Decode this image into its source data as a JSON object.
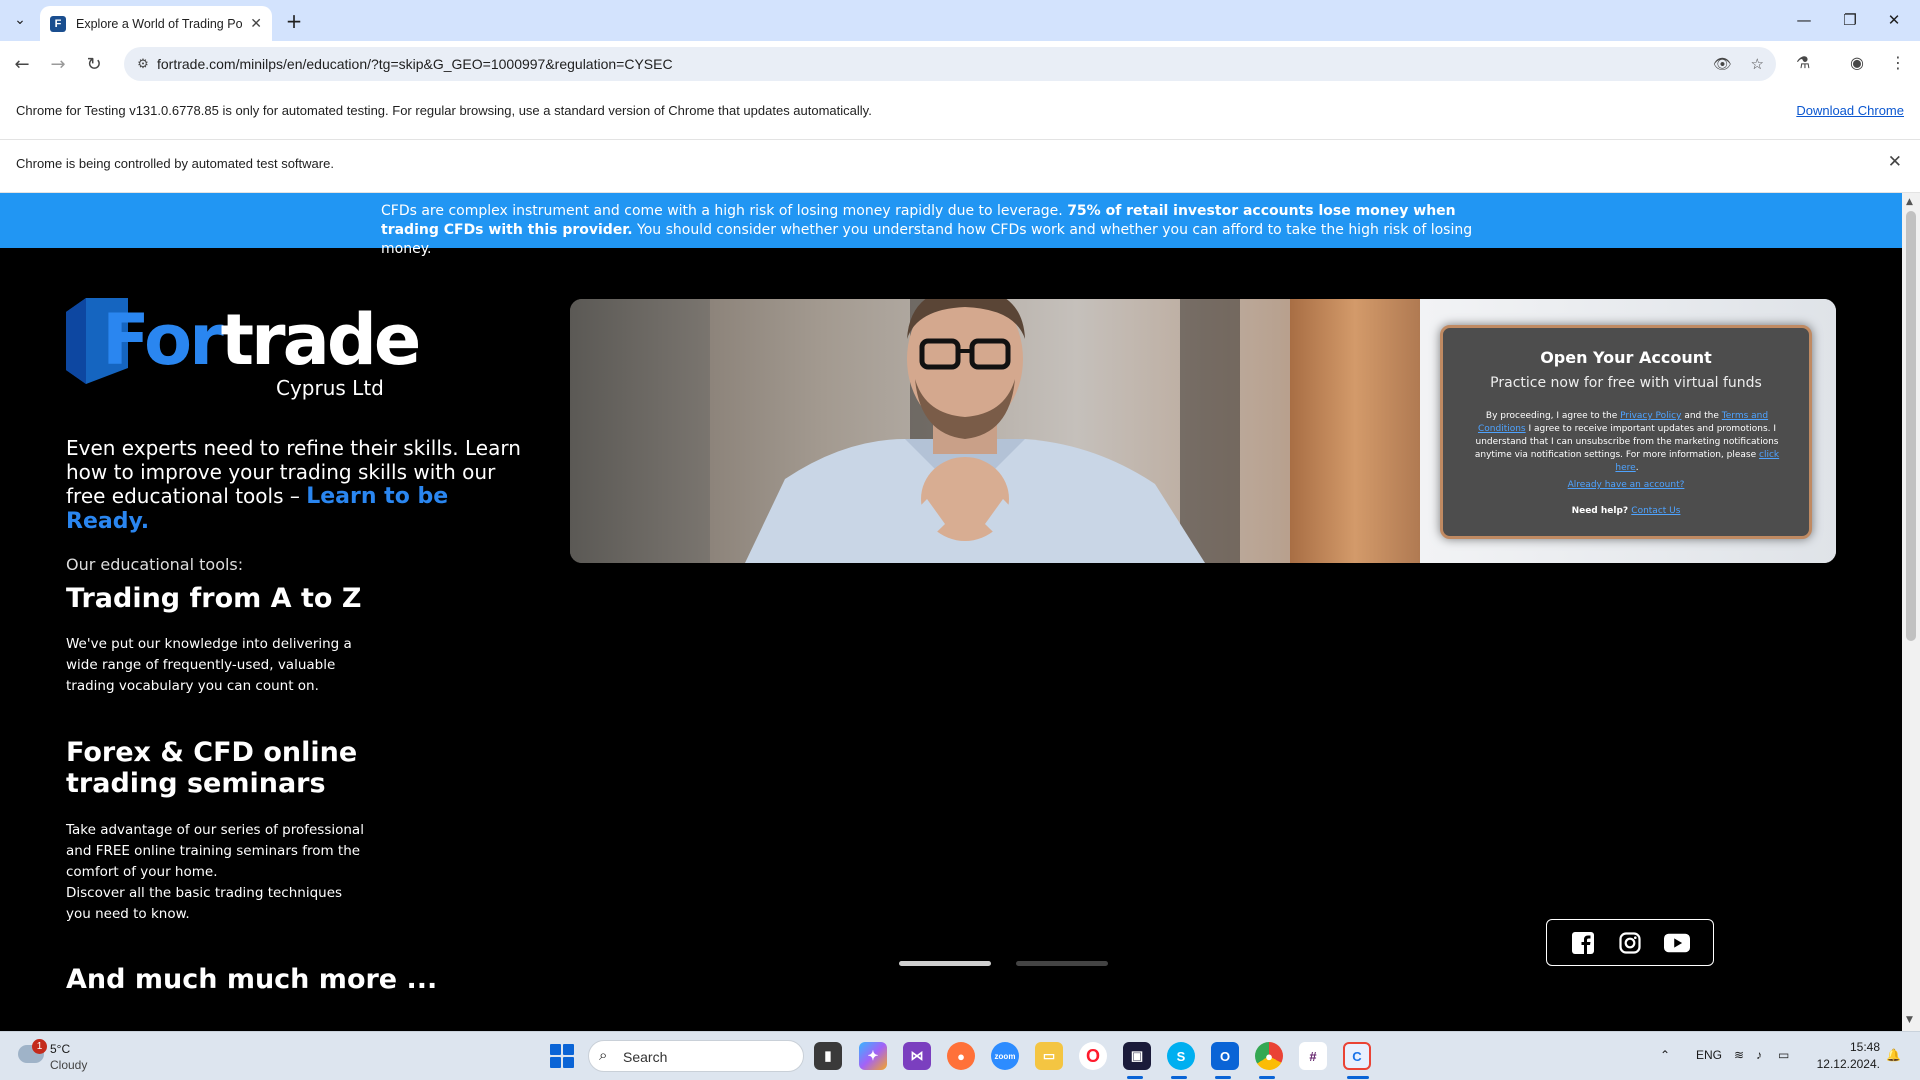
{
  "browser": {
    "tab_title": "Explore a World of Trading Possibilities",
    "url": "fortrade.com/minilps/en/education/?tg=skip&G_GEO=1000997&regulation=CYSEC",
    "info_testing": "Chrome for Testing v131.0.6778.85 is only for automated testing. For regular browsing, use a standard version of Chrome that updates automatically.",
    "download_link": "Download Chrome",
    "info_automation": "Chrome is being controlled by automated test software."
  },
  "banner": {
    "text_a": "CFDs are complex instrument and come with a high risk of losing money rapidly due to leverage.",
    "text_b": "75% of retail investor accounts lose money when trading CFDs with this provider.",
    "text_c": "You should consider whether you understand how CFDs work and whether you can afford to take the high risk of losing money."
  },
  "brand": {
    "word_a": "For",
    "word_b": "trade",
    "subtitle": "Cyprus Ltd"
  },
  "intro": {
    "text": "Even experts need to refine their skills. Learn how to improve your trading skills with our free educational tools –",
    "accent": "Learn to be Ready."
  },
  "tools": {
    "label": "Our educational tools:",
    "section1_title": "Trading from A to Z",
    "section1_body": "We've put our knowledge into delivering a wide range of frequently-used, valuable trading vocabulary you can count on.",
    "section2_title": "Forex & CFD online trading seminars",
    "section2_body1": "Take advantage of our series of professional and FREE online training seminars from the comfort of your home.",
    "section2_body2": "Discover all the basic trading techniques you need to know.",
    "section3_title": "And much much more ..."
  },
  "form": {
    "title": "Open Your Account",
    "subtitle": "Practice now for free with virtual funds",
    "legal_1": "By proceeding, I agree to the",
    "privacy_link": "Privacy Policy",
    "legal_and": "and the",
    "terms_link": "Terms and Conditions",
    "legal_2": "I agree to receive important updates and promotions. I understand that I can unsubscribe from the marketing notifications anytime via notification settings. For more information, please",
    "click_here": "click here",
    "legal_end": ".",
    "already_link": "Already have an account?",
    "help_label": "Need help?",
    "contact_link": "Contact Us"
  },
  "carousel": {
    "active_index": 0,
    "count": 2
  },
  "social": [
    "facebook-icon",
    "instagram-icon",
    "youtube-icon"
  ],
  "taskbar": {
    "weather_badge": "1",
    "weather_temp": "5°C",
    "weather_desc": "Cloudy",
    "search_placeholder": "Search",
    "lang": "ENG",
    "time": "15:48",
    "date": "12.12.2024."
  },
  "colors": {
    "banner_blue": "#2196f3",
    "brand_blue": "#2a86f0",
    "form_border": "#c08a62",
    "link_blue": "#4ea3ff"
  }
}
